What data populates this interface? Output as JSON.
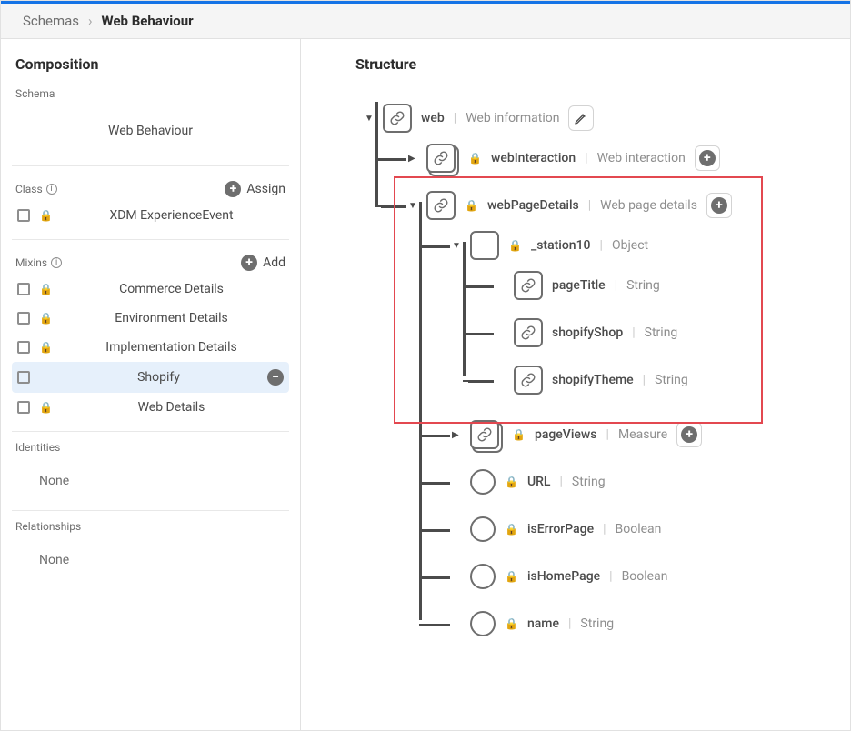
{
  "breadcrumb": {
    "parent": "Schemas",
    "current": "Web Behaviour"
  },
  "sidebar": {
    "title": "Composition",
    "sections": {
      "schema": {
        "label": "Schema",
        "name": "Web Behaviour"
      },
      "class": {
        "label": "Class",
        "assign": "Assign",
        "item": "XDM ExperienceEvent"
      },
      "mixins": {
        "label": "Mixins",
        "add": "Add",
        "items": [
          {
            "label": "Commerce Details",
            "locked": true
          },
          {
            "label": "Environment Details",
            "locked": true
          },
          {
            "label": "Implementation Details",
            "locked": true
          },
          {
            "label": "Shopify",
            "locked": false,
            "selected": true
          },
          {
            "label": "Web Details",
            "locked": true
          }
        ]
      },
      "identities": {
        "label": "Identities",
        "none": "None"
      },
      "relationships": {
        "label": "Relationships",
        "none": "None"
      }
    }
  },
  "structure": {
    "title": "Structure",
    "root": {
      "name": "web",
      "type": "Web information",
      "children": [
        {
          "name": "webInteraction",
          "type": "Web interaction",
          "locked": true,
          "multi": true,
          "collapsed": true,
          "add": true
        },
        {
          "name": "webPageDetails",
          "type": "Web page details",
          "locked": true,
          "add": true,
          "children": [
            {
              "name": "_station10",
              "type": "Object",
              "locked": true,
              "plain": true,
              "children": [
                {
                  "name": "pageTitle",
                  "type": "String"
                },
                {
                  "name": "shopifyShop",
                  "type": "String"
                },
                {
                  "name": "shopifyTheme",
                  "type": "String"
                }
              ]
            },
            {
              "name": "pageViews",
              "type": "Measure",
              "locked": true,
              "multi": true,
              "collapsed": true,
              "add": true
            },
            {
              "name": "URL",
              "type": "String",
              "locked": true,
              "leaf": true
            },
            {
              "name": "isErrorPage",
              "type": "Boolean",
              "locked": true,
              "leaf": true
            },
            {
              "name": "isHomePage",
              "type": "Boolean",
              "locked": true,
              "leaf": true
            },
            {
              "name": "name",
              "type": "String",
              "locked": true,
              "leaf": true
            }
          ]
        }
      ]
    }
  }
}
